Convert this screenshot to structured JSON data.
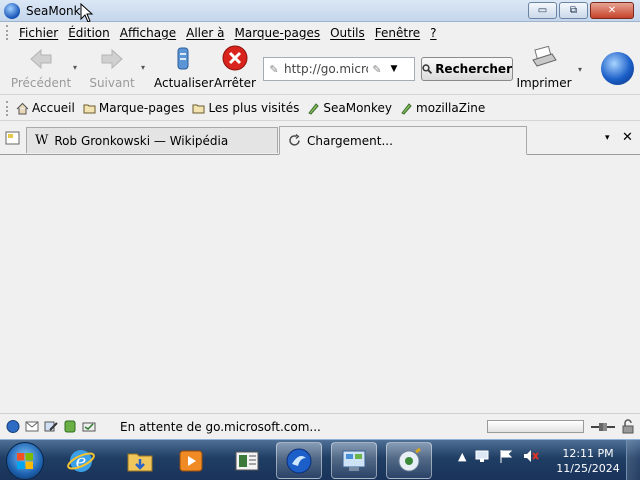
{
  "window": {
    "title": "SeaMonke",
    "buttons": {
      "minimize": "▭",
      "restore": "⧉",
      "close": "✕"
    }
  },
  "menubar": {
    "items": [
      "Fichier",
      "Édition",
      "Affichage",
      "Aller à",
      "Marque-pages",
      "Outils",
      "Fenêtre",
      "?"
    ]
  },
  "navbar": {
    "back": "Précédent",
    "forward": "Suivant",
    "reload": "Actualiser",
    "stop": "Arrêter",
    "url": "http://go.micro",
    "search": "Rechercher",
    "print": "Imprimer"
  },
  "personalbar": {
    "items": [
      "Accueil",
      "Marque-pages",
      "Les plus visités",
      "SeaMonkey",
      "mozillaZine"
    ]
  },
  "tabs": [
    {
      "label": "Rob Gronkowski — Wikipédia",
      "icon": "W"
    },
    {
      "label": "Chargement...",
      "icon": "loading-icon"
    }
  ],
  "statusbar": {
    "text": "En attente de go.microsoft.com..."
  },
  "taskbar": {
    "time": "12:11 PM",
    "date": "11/25/2024"
  },
  "colors": {
    "stop_red": "#d8241c",
    "taskbar": "#203e64",
    "titlebar": "#c4d6ec"
  }
}
